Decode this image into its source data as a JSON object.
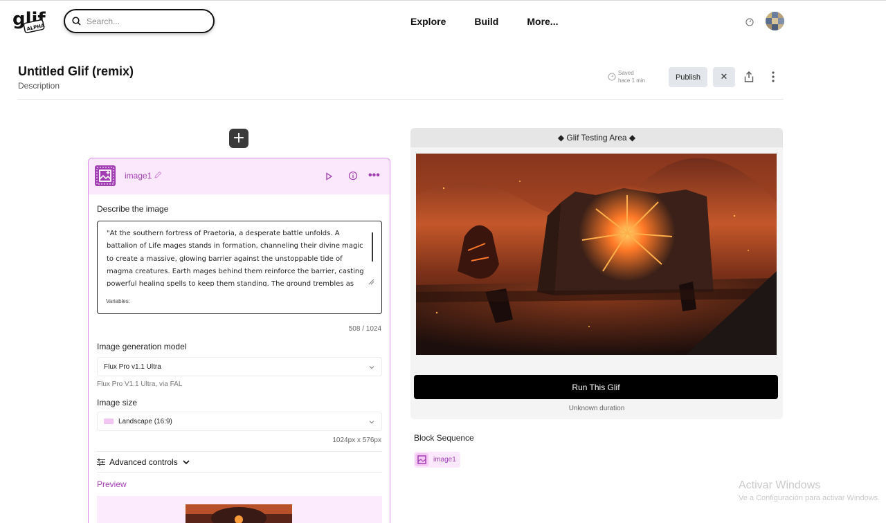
{
  "nav": {
    "search_placeholder": "Search...",
    "logo_text": "glif",
    "logo_badge": "ALPHA",
    "links": [
      "Explore",
      "Build",
      "More..."
    ]
  },
  "header": {
    "title": "Untitled Glif (remix)",
    "description": "Description",
    "saved_label": "Saved",
    "saved_time": "hace 1 min",
    "publish_label": "Publish",
    "close_label": "✕"
  },
  "block": {
    "name": "image1",
    "describe_label": "Describe the image",
    "prompt": "\"At the southern fortress of Praetoria, a desperate battle unfolds. A battalion of Life mages stands in formation, channeling their divine magic to create a massive, glowing barrier against the unstoppable tide of magma creatures. Earth mages behind them reinforce the barrier, casting powerful healing spells to keep them standing. The ground trembles as the fiery monsters advance, their",
    "variables_label": "Variables:",
    "char_count": "508 / 1024",
    "model_label": "Image generation model",
    "model_value": "Flux Pro v1.1 Ultra",
    "model_note": "Flux Pro V1.1 Ultra, via FAL",
    "size_label": "Image size",
    "size_value": "Landscape (16:9)",
    "size_dims": "1024px x 576px",
    "advanced_label": "Advanced controls",
    "preview_label": "Preview"
  },
  "testing": {
    "header": "◆ Glif Testing Area ◆",
    "run_label": "Run This Glif",
    "duration": "Unknown duration"
  },
  "sequence": {
    "label": "Block Sequence",
    "items": [
      "image1"
    ]
  },
  "watermark": {
    "line1": "Activar Windows",
    "line2": "Ve a Configuración para activar Windows."
  },
  "colors": {
    "accent": "#a23fb3",
    "block_bg": "#fce8fc",
    "run_button": "#000000"
  }
}
